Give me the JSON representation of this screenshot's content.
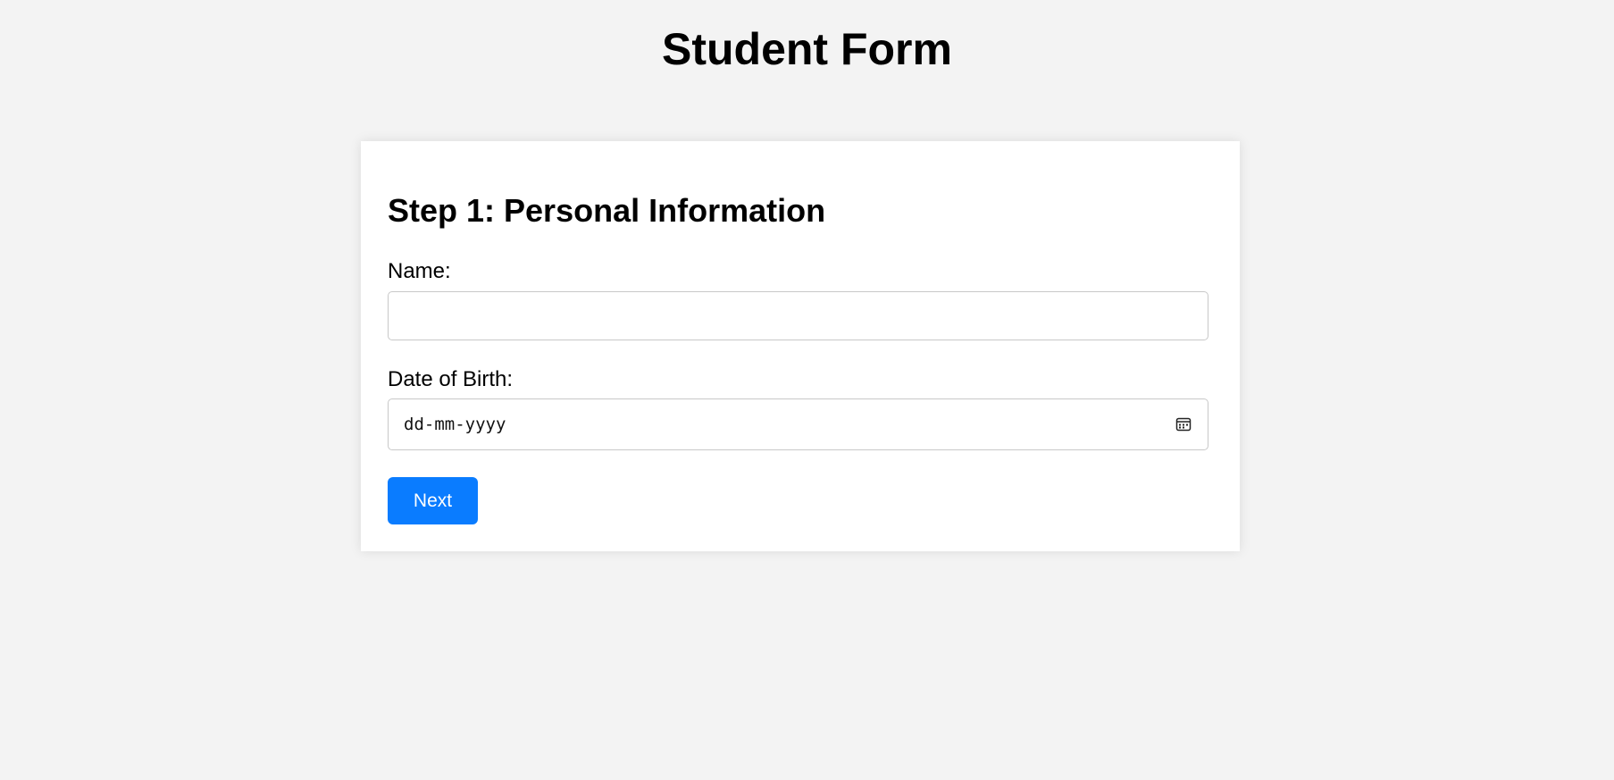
{
  "page": {
    "title": "Student Form"
  },
  "form": {
    "step_title": "Step 1: Personal Information",
    "name_label": "Name:",
    "name_value": "",
    "dob_label": "Date of Birth:",
    "dob_placeholder": "dd-mm-yyyy",
    "dob_icon": "calendar-icon",
    "next_label": "Next"
  },
  "colors": {
    "page_background": "#f3f3f3",
    "card_background": "#ffffff",
    "primary_button": "#0a7cff",
    "input_border": "#c8c8c8"
  }
}
